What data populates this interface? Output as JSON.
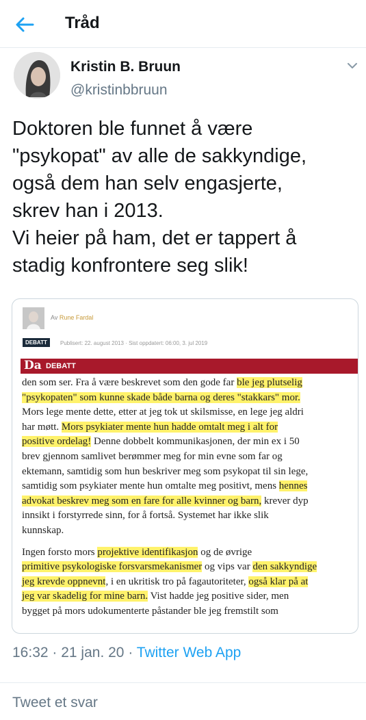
{
  "header": {
    "title": "Tråd"
  },
  "tweet": {
    "author_name": "Kristin B. Bruun",
    "author_handle": "@kristinbbruun",
    "text": "Doktoren ble funnet å være\n\"psykopat\" av alle de sakkyndige,\nogså dem han selv engasjerte,\nskrev han i 2013.\nVi heier på ham, det er tappert å\nstadig konfrontere seg slik!",
    "time": "16:32",
    "date": "21 jan. 20",
    "source": "Twitter Web App"
  },
  "card": {
    "byline_prefix": "Av",
    "byline_author": "Rune Fardal",
    "tag": "DEBATT",
    "published": "Publisert: 22. august 2013 · Sist oppdatert: 06:00, 3. jul 2019",
    "banner_logo": "Da",
    "banner_label": "DEBATT",
    "lines": [
      [
        {
          "t": "den som ser. Fra å være beskrevet som den gode far "
        },
        {
          "t": "ble jeg plutselig",
          "h": true
        }
      ],
      [
        {
          "t": "\"psykopaten\" som kunne skade både barna og deres \"stakkars\" mor.",
          "h": true
        }
      ],
      [
        {
          "t": "Mors lege mente dette, etter at jeg tok ut skilsmisse, en lege jeg aldri"
        }
      ],
      [
        {
          "t": "har møtt. "
        },
        {
          "t": "Mors psykiater mente hun hadde omtalt meg i alt for",
          "h": true
        }
      ],
      [
        {
          "t": "positive ordelag!",
          "h": true
        },
        {
          "t": " Denne dobbelt kommunikasjonen, der min ex i 50"
        }
      ],
      [
        {
          "t": "brev gjennom samlivet berømmer meg for min evne som far og"
        }
      ],
      [
        {
          "t": "ektemann, samtidig som hun beskriver meg som psykopat til sin lege,"
        }
      ],
      [
        {
          "t": "samtidig som psykiater mente hun omtalte meg positivt, mens "
        },
        {
          "t": "hennes",
          "h": true
        }
      ],
      [
        {
          "t": "advokat beskrev meg som en fare for alle kvinner og barn,",
          "h": true
        },
        {
          "t": " krever dyp"
        }
      ],
      [
        {
          "t": "innsikt i forstyrrede sinn, for å fortså. Systemet har ikke slik"
        }
      ],
      [
        {
          "t": "kunnskap."
        }
      ],
      [],
      [
        {
          "t": "  Ingen forsto mors "
        },
        {
          "t": "projektive identifikasjon",
          "h": true
        },
        {
          "t": " og de øvrige"
        }
      ],
      [
        {
          "t": "primitive psykologiske forsvarsmekanismer",
          "h": true
        },
        {
          "t": " og vips var "
        },
        {
          "t": "den sakkyndige",
          "h": true
        }
      ],
      [
        {
          "t": "jeg krevde oppnevnt",
          "h": true
        },
        {
          "t": ", i en ukritisk tro på fagautoriteter, "
        },
        {
          "t": "også klar på at",
          "h": true
        }
      ],
      [
        {
          "t": "jeg var skadelig for mine barn.",
          "h": true
        },
        {
          "t": " Vist hadde jeg positive sider, men"
        }
      ],
      [
        {
          "t": "bygget på mors udokumenterte påstander ble jeg fremstilt som"
        }
      ]
    ]
  },
  "reply": {
    "placeholder": "Tweet et svar"
  },
  "colors": {
    "accent": "#1da1f2",
    "muted": "#657786",
    "highlight": "#fff26b",
    "banner": "#a8192b"
  },
  "icons": {
    "back": "arrow-left-icon",
    "caret": "chevron-down-icon"
  }
}
